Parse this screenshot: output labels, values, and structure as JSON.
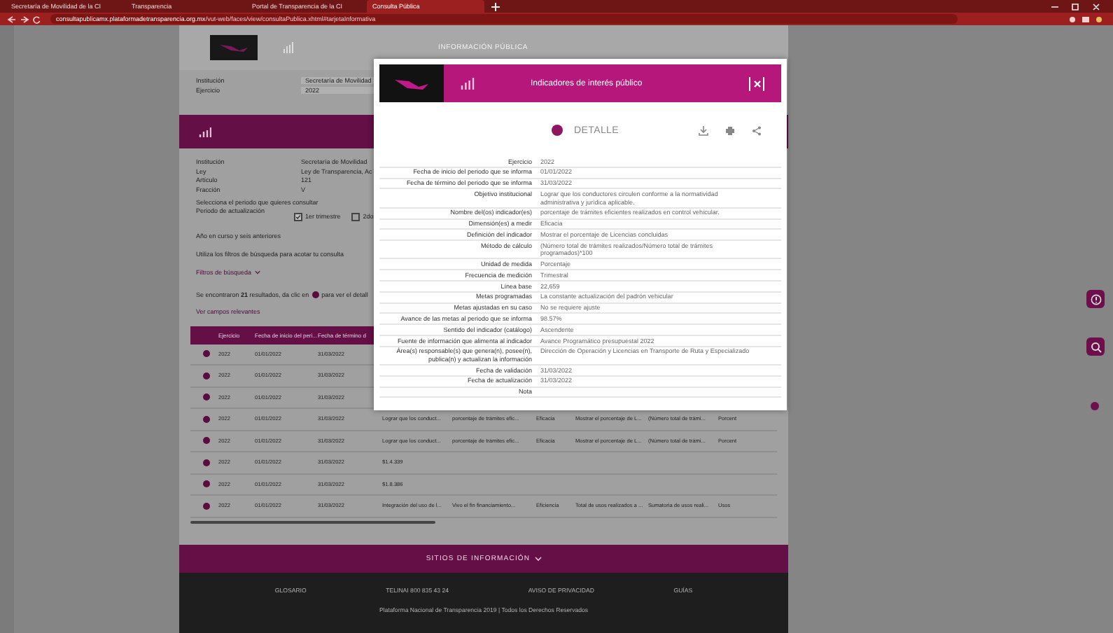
{
  "browser": {
    "tabs": [
      {
        "title": "Secretaría de Movilidad de la CI",
        "selected": false
      },
      {
        "title": "Transparencia",
        "selected": false
      },
      {
        "title": "Portal de Transparencia de la CI",
        "selected": false
      },
      {
        "title": "Consulta Pública",
        "selected": true
      }
    ],
    "url_host": "consultapublicamx.plataformadetransparencia.org.mx",
    "url_path": "/vut-web/faces/view/consultaPublica.xhtml#tarjetaInformativa"
  },
  "page": {
    "section_title": "INFORMACIÓN PÚBLICA",
    "filters": [
      {
        "label": "Institución",
        "value": "Secretaría de Movilidad"
      },
      {
        "label": "Ejercicio",
        "value": "2022"
      }
    ],
    "details": [
      {
        "label": "Institución",
        "value": "Secretaría de Movilidad"
      },
      {
        "label": "Ley",
        "value": "Ley de Transparencia, Ac"
      },
      {
        "label": "Artículo",
        "value": "121"
      },
      {
        "label": "Fracción",
        "value": "V"
      }
    ],
    "period_prompt": "Selecciona el periodo que quieres consultar",
    "period_label": "Periodo de actualización",
    "periods": [
      {
        "label": "1er trimestre",
        "checked": true
      },
      {
        "label": "2do",
        "checked": false
      }
    ],
    "scope_note": "Año en curso y seis anteriores",
    "filter_note": "Utiliza los filtros de búsqueda para acotar tu consulta",
    "filters_link": "Filtros de búsqueda",
    "results_before": "Se encontraron **21** resultados, da clic en",
    "results_after": "para ver el detall",
    "relevant_link": "Ver campos relevantes",
    "table": {
      "columns": [
        "Ejercicio",
        "Fecha de inicio del peri...",
        "Fecha de término d"
      ],
      "rows": [
        {
          "cells": [
            "2022",
            "01/01/2022",
            "31/03/2022"
          ]
        },
        {
          "cells": [
            "2022",
            "01/01/2022",
            "31/03/2022"
          ]
        },
        {
          "cells": [
            "2022",
            "01/01/2022",
            "31/03/2022"
          ]
        },
        {
          "cells": [
            "2022",
            "01/01/2022",
            "31/03/2022",
            "Lograr que los conduct...",
            "porcentaje de trámites efic...",
            "Eficacia",
            "Mostrar el porcentaje de L...",
            "(Número total de trámi...",
            "Porcent"
          ]
        },
        {
          "cells": [
            "2022",
            "01/01/2022",
            "31/03/2022",
            "Lograr que los conduct...",
            "porcentaje de trámites efic...",
            "Eficacia",
            "Mostrar el porcentaje de L...",
            "(Número total de trámi...",
            "Porcent"
          ]
        },
        {
          "cells": [
            "2022",
            "01/01/2022",
            "31/03/2022",
            "$1.4.339"
          ]
        },
        {
          "cells": [
            "2022",
            "01/01/2022",
            "31/03/2022",
            "$1.8.386"
          ]
        },
        {
          "cells": [
            "2022",
            "01/01/2022",
            "31/03/2022",
            "Integración del uso de l...",
            "Vivo el fin financiamiento...",
            "Eficiencia",
            "Total de usos realizados a ...",
            "Sumatoria de usos reali...",
            "Usos"
          ]
        }
      ]
    }
  },
  "modal": {
    "title": "Indicadores de interés público",
    "section": "DETALLE",
    "rows": [
      {
        "label": "Ejercicio",
        "value": "2022"
      },
      {
        "label": "Fecha de inicio del periodo que se informa",
        "value": "01/01/2022"
      },
      {
        "label": "Fecha de término del periodo que se informa",
        "value": "31/03/2022"
      },
      {
        "label": "Objetivo institucional",
        "value": "Lograr que los conductores circulen conforme a la normatividad administrativa y jurídica aplicable."
      },
      {
        "label": "Nombre del(os) indicador(es)",
        "value": "porcentaje de trámites eficientes realizados en control vehicular."
      },
      {
        "label": "Dimensión(es) a medir",
        "value": "Eficacia"
      },
      {
        "label": "Definición del indicador",
        "value": "Mostrar el porcentaje de Licencias concluidas"
      },
      {
        "label": "Método de cálculo",
        "value": "(Número total de trámites realizados/Número total de trámites programados)*100"
      },
      {
        "label": "Unidad de medida",
        "value": "Porcentaje"
      },
      {
        "label": "Frecuencia de medición",
        "value": "Trimestral"
      },
      {
        "label": "Línea base",
        "value": "22,659"
      },
      {
        "label": "Metas programadas",
        "value": "La constante actualización del padrón vehicular"
      },
      {
        "label": "Metas ajustadas en su caso",
        "value": "No se requiere ajuste"
      },
      {
        "label": "Avance de las metas al periodo que se informa",
        "value": "98.57%"
      },
      {
        "label": "Sentido del indicador (catálogo)",
        "value": "Ascendente"
      },
      {
        "label": "Fuente de información que alimenta al indicador",
        "value": "Avance Programático presupuestal 2022"
      },
      {
        "label": "Área(s) responsable(s) que genera(n), posee(n), publica(n) y actualizan la información",
        "value": "Dirección de Operación y Licencias en Transporte de Ruta y Especializado"
      },
      {
        "label": "Fecha de validación",
        "value": "31/03/2022"
      },
      {
        "label": "Fecha de actualización",
        "value": "31/03/2022"
      },
      {
        "label": "Nota"
      }
    ]
  },
  "footer": {
    "title": "SITIOS DE INFORMACIÓN",
    "links": [
      "GLOSARIO",
      "TELINAI 800 835 43 24",
      "AVISO DE PRIVACIDAD",
      "GUÍAS"
    ],
    "copyright": "Plataforma Nacional de Transparencia 2019 | Todos los Derechos Reservados"
  }
}
